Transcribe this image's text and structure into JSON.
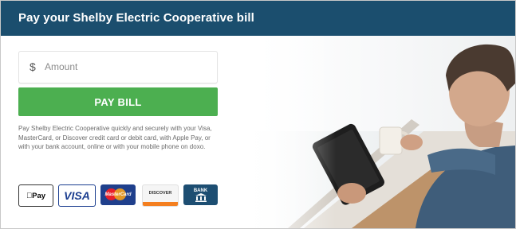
{
  "header": {
    "title": "Pay your Shelby Electric Cooperative bill"
  },
  "form": {
    "currency_symbol": "$",
    "amount_placeholder": "Amount",
    "pay_button_label": "PAY BILL",
    "description": "Pay Shelby Electric Cooperative quickly and securely with your Visa, MasterCard, or Discover credit card or debit card, with Apple Pay, or with your bank account, online or with your mobile phone on doxo."
  },
  "payment_methods": {
    "apple_pay": "Pay",
    "visa": "VISA",
    "mastercard": "MasterCard",
    "discover": "DISCOVER",
    "bank": "BANK"
  },
  "colors": {
    "header_bg": "#1b4e6e",
    "pay_button": "#4caf50"
  },
  "icons": [
    "apple-pay-icon",
    "visa-icon",
    "mastercard-icon",
    "discover-icon",
    "bank-icon"
  ]
}
